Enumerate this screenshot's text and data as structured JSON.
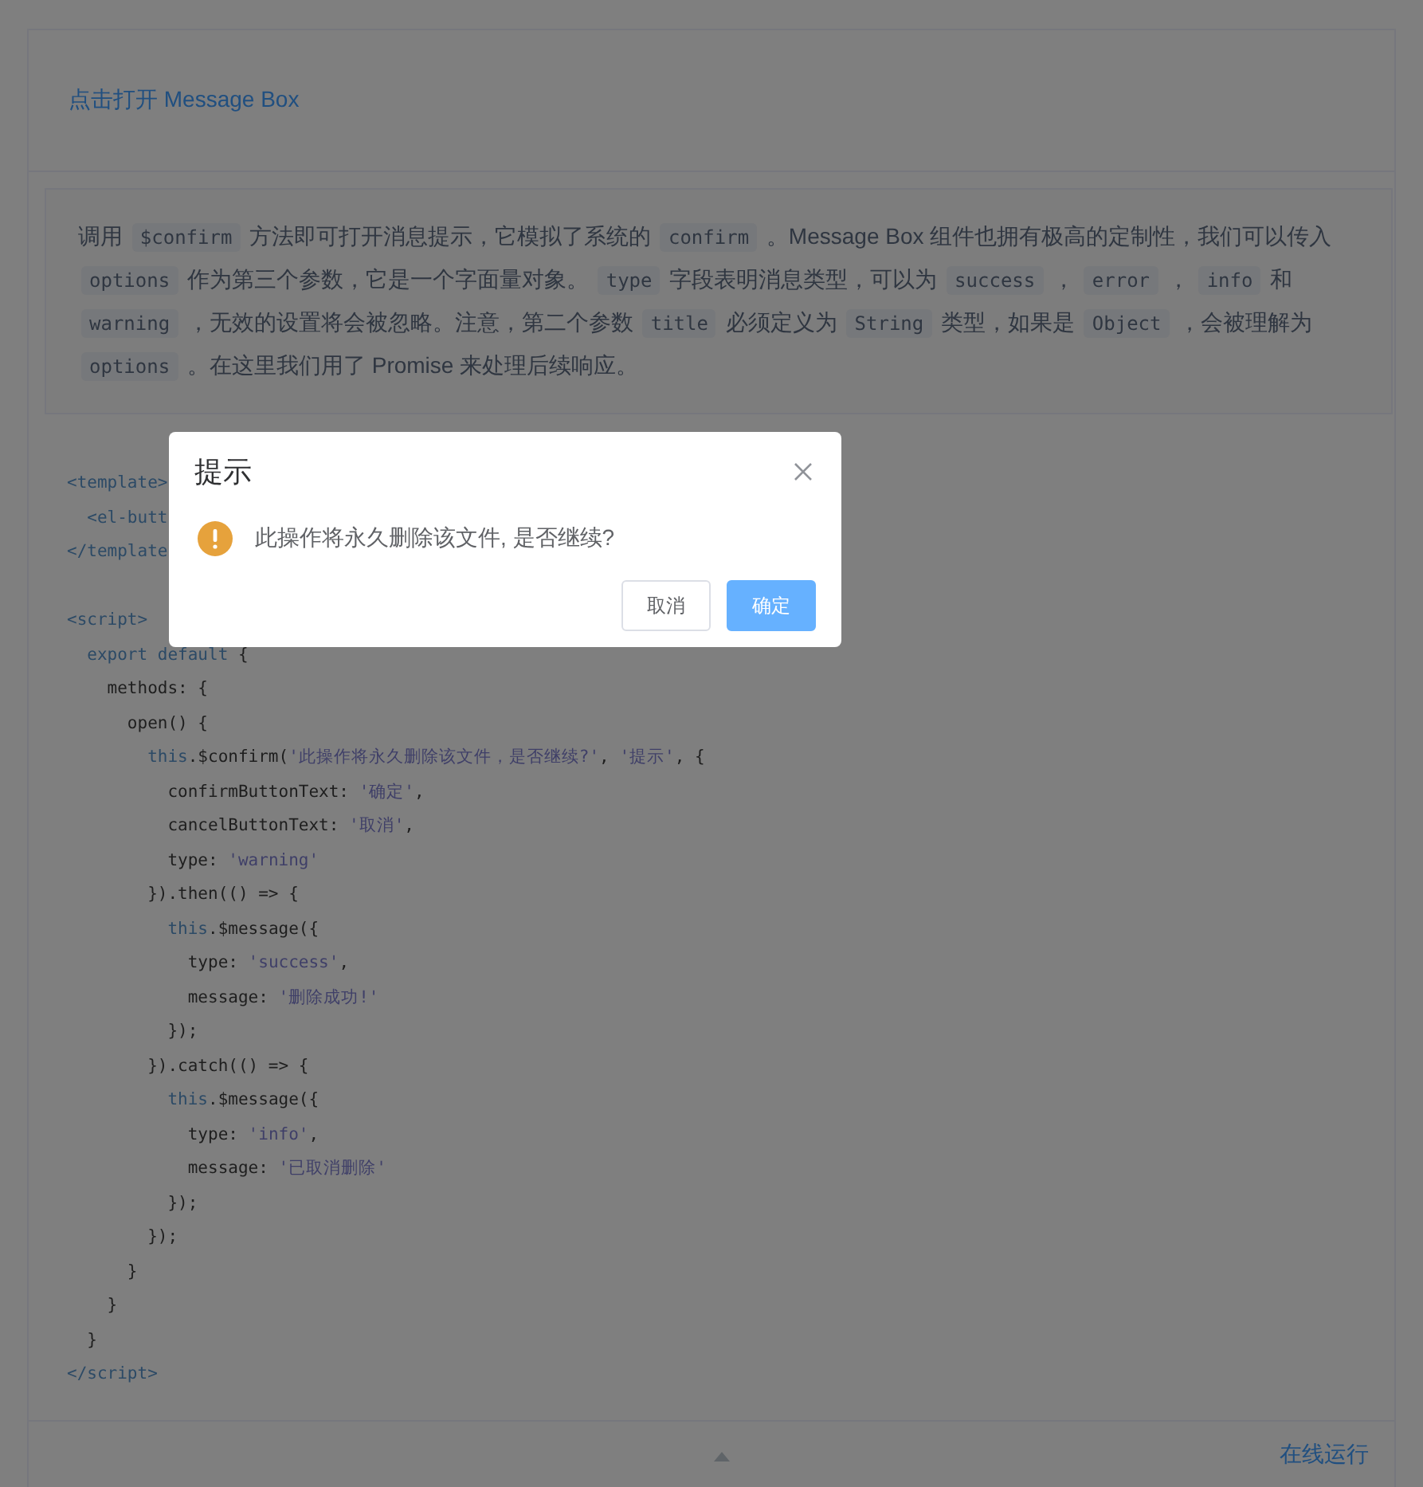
{
  "demo": {
    "link": "点击打开 Message Box"
  },
  "description": [
    {
      "text": "调用 ",
      "kind": "text"
    },
    {
      "text": "$confirm",
      "kind": "code"
    },
    {
      "text": " 方法即可打开消息提示，它模拟了系统的 ",
      "kind": "text"
    },
    {
      "text": "confirm",
      "kind": "code"
    },
    {
      "text": " 。Message Box 组件也拥有极高的定制性，我们可以传入 ",
      "kind": "text"
    },
    {
      "text": "options",
      "kind": "code"
    },
    {
      "text": " 作为第三个参数，它是一个字面量对象。 ",
      "kind": "text"
    },
    {
      "text": "type",
      "kind": "code"
    },
    {
      "text": " 字段表明消息类型，可以为 ",
      "kind": "text"
    },
    {
      "text": "success",
      "kind": "code"
    },
    {
      "text": " ， ",
      "kind": "text"
    },
    {
      "text": "error",
      "kind": "code"
    },
    {
      "text": " ， ",
      "kind": "text"
    },
    {
      "text": "info",
      "kind": "code"
    },
    {
      "text": " 和 ",
      "kind": "text"
    },
    {
      "text": "warning",
      "kind": "code"
    },
    {
      "text": " ，无效的设置将会被忽略。注意，第二个参数 ",
      "kind": "text"
    },
    {
      "text": "title",
      "kind": "code"
    },
    {
      "text": " 必须定义为 ",
      "kind": "text"
    },
    {
      "text": "String",
      "kind": "code"
    },
    {
      "text": " 类型，如果是 ",
      "kind": "text"
    },
    {
      "text": "Object",
      "kind": "code"
    },
    {
      "text": " ，会被理解为 ",
      "kind": "text"
    },
    {
      "text": "options",
      "kind": "code"
    },
    {
      "text": " 。在这里我们用了 Promise 来处理后续响应。",
      "kind": "text"
    }
  ],
  "code_blocks": [
    [
      [
        {
          "kind": "tag",
          "t": "<template>"
        }
      ],
      [
        {
          "kind": "tag",
          "t": "  <el-butt"
        }
      ],
      [
        {
          "kind": "tag",
          "t": "</template"
        }
      ]
    ],
    [
      [
        {
          "kind": "tag",
          "t": "<script>"
        }
      ],
      [
        {
          "kind": "kw",
          "t": "  export default"
        },
        {
          "kind": "plain",
          "t": " {"
        }
      ],
      [
        {
          "kind": "plain",
          "t": "    methods: {"
        }
      ],
      [
        {
          "kind": "plain",
          "t": "      open() {"
        }
      ],
      [
        {
          "kind": "kw",
          "t": "        this"
        },
        {
          "kind": "plain",
          "t": ".$confirm("
        },
        {
          "kind": "str",
          "t": "'此操作将永久删除该文件，是否继续?'"
        },
        {
          "kind": "plain",
          "t": ", "
        },
        {
          "kind": "str",
          "t": "'提示'"
        },
        {
          "kind": "plain",
          "t": ", {"
        }
      ],
      [
        {
          "kind": "plain",
          "t": "          confirmButtonText: "
        },
        {
          "kind": "str",
          "t": "'确定'"
        },
        {
          "kind": "plain",
          "t": ","
        }
      ],
      [
        {
          "kind": "plain",
          "t": "          cancelButtonText: "
        },
        {
          "kind": "str",
          "t": "'取消'"
        },
        {
          "kind": "plain",
          "t": ","
        }
      ],
      [
        {
          "kind": "plain",
          "t": "          type: "
        },
        {
          "kind": "str",
          "t": "'warning'"
        }
      ],
      [
        {
          "kind": "plain",
          "t": "        }).then(() => {"
        }
      ],
      [
        {
          "kind": "kw",
          "t": "          this"
        },
        {
          "kind": "plain",
          "t": ".$message({"
        }
      ],
      [
        {
          "kind": "plain",
          "t": "            type: "
        },
        {
          "kind": "str",
          "t": "'success'"
        },
        {
          "kind": "plain",
          "t": ","
        }
      ],
      [
        {
          "kind": "plain",
          "t": "            message: "
        },
        {
          "kind": "str",
          "t": "'删除成功!'"
        }
      ],
      [
        {
          "kind": "plain",
          "t": "          });"
        }
      ],
      [
        {
          "kind": "plain",
          "t": "        }).catch(() => {"
        }
      ],
      [
        {
          "kind": "kw",
          "t": "          this"
        },
        {
          "kind": "plain",
          "t": ".$message({"
        }
      ],
      [
        {
          "kind": "plain",
          "t": "            type: "
        },
        {
          "kind": "str",
          "t": "'info'"
        },
        {
          "kind": "plain",
          "t": ","
        }
      ],
      [
        {
          "kind": "plain",
          "t": "            message: "
        },
        {
          "kind": "str",
          "t": "'已取消删除'"
        }
      ],
      [
        {
          "kind": "plain",
          "t": "          });"
        }
      ],
      [
        {
          "kind": "plain",
          "t": "        });"
        }
      ],
      [
        {
          "kind": "plain",
          "t": "      }"
        }
      ],
      [
        {
          "kind": "plain",
          "t": "    }"
        }
      ],
      [
        {
          "kind": "plain",
          "t": "  }"
        }
      ],
      [
        {
          "kind": "tag",
          "t": "</script>"
        }
      ]
    ]
  ],
  "footer": {
    "run_link": "在线运行"
  },
  "dialog": {
    "title": "提示",
    "kind": "warning",
    "message": "此操作将永久删除该文件, 是否继续?",
    "buttons": [
      {
        "label": "取消",
        "kind": "default"
      },
      {
        "label": "确定",
        "kind": "primary"
      }
    ]
  }
}
